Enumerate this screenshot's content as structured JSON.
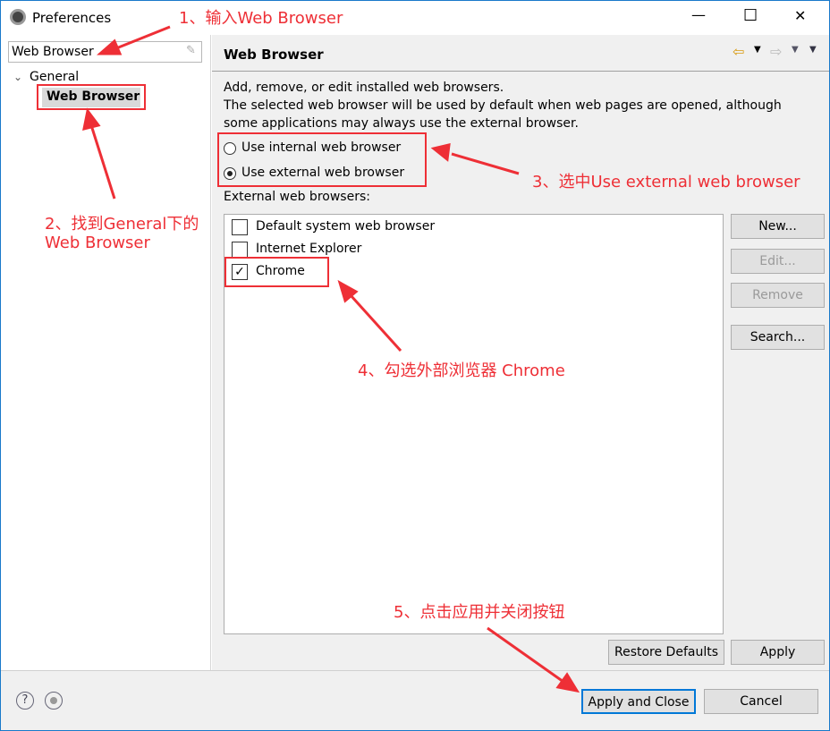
{
  "window": {
    "title": "Preferences",
    "minimize": "—",
    "maximize": "☐",
    "close": "✕"
  },
  "filter": {
    "value": "Web Browser",
    "clear_icon": "eraser-icon"
  },
  "tree": {
    "parent": "General",
    "child": "Web Browser"
  },
  "page": {
    "title": "Web Browser",
    "description": [
      "Add, remove, or edit installed web browsers.",
      "The selected web browser will be used by default when web pages are opened, although",
      "some applications may always use the external browser."
    ],
    "radio_internal": "Use internal web browser",
    "radio_external": "Use external web browser",
    "selected": "external",
    "list_label": "External web browsers:",
    "browsers": [
      {
        "name": "Default system web browser",
        "checked": false
      },
      {
        "name": "Internet Explorer",
        "checked": false
      },
      {
        "name": "Chrome",
        "checked": true
      }
    ],
    "buttons": {
      "new": "New...",
      "edit": "Edit...",
      "remove": "Remove",
      "search": "Search..."
    },
    "restore": "Restore Defaults",
    "apply": "Apply"
  },
  "footer": {
    "apply_close": "Apply and Close",
    "cancel": "Cancel"
  },
  "annotations": {
    "a1": "1、输入Web Browser",
    "a2a": "2、找到General下的",
    "a2b": "Web Browser",
    "a3": "3、选中Use external web browser",
    "a4": "4、勾选外部浏览器 Chrome",
    "a5": "5、点击应用并关闭按钮",
    "color": "#ee2f36"
  }
}
